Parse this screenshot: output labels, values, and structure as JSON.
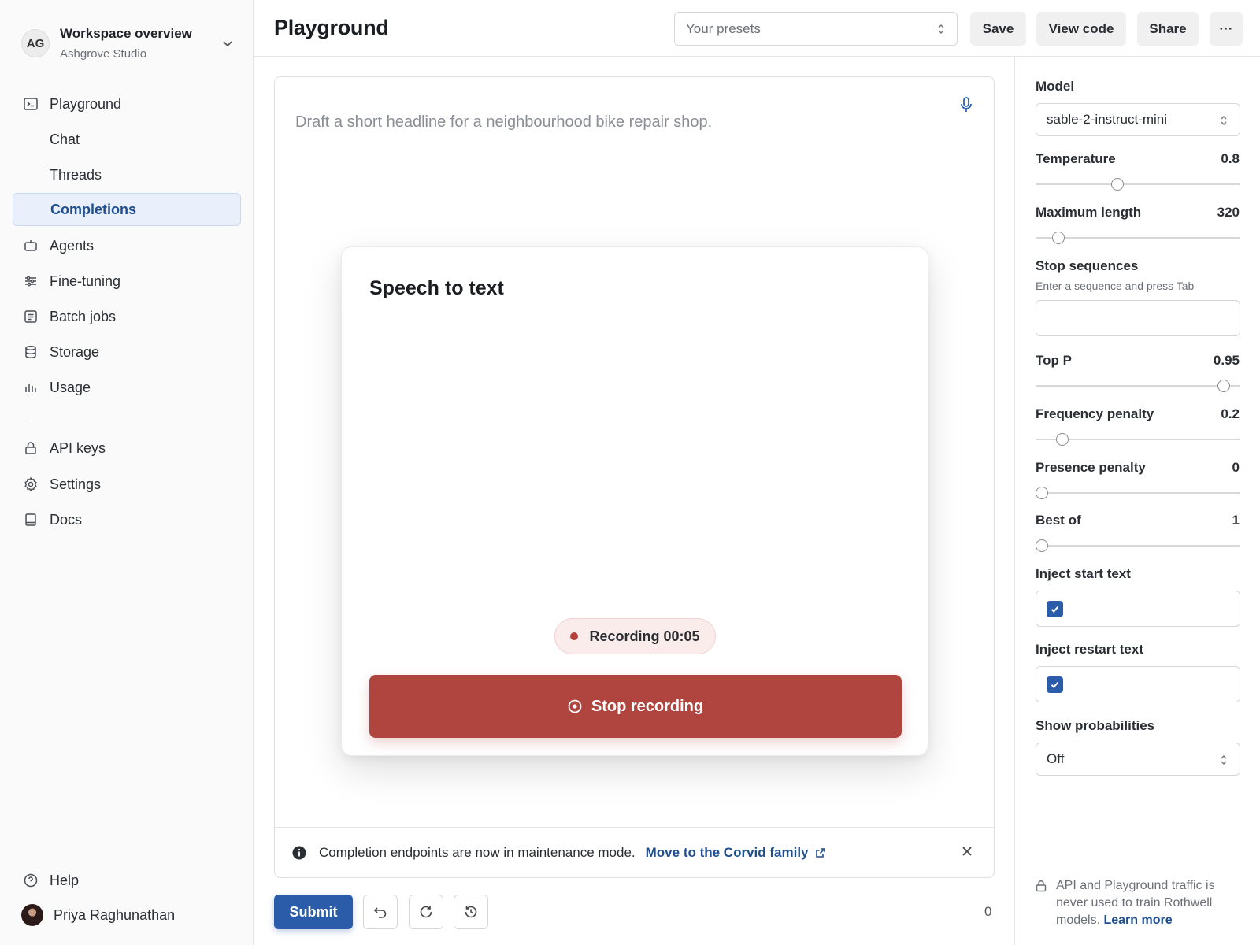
{
  "workspace": {
    "initials": "AG",
    "title": "Workspace overview",
    "subtitle": "Ashgrove Studio"
  },
  "sidebar": {
    "items": [
      {
        "label": "Playground",
        "icon": "terminal-icon"
      },
      {
        "label": "Chat"
      },
      {
        "label": "Threads"
      },
      {
        "label": "Completions",
        "active": true
      },
      {
        "label": "Agents",
        "icon": "robot-icon"
      },
      {
        "label": "Fine-tuning",
        "icon": "sliders-icon"
      },
      {
        "label": "Batch jobs",
        "icon": "list-icon"
      },
      {
        "label": "Storage",
        "icon": "database-icon"
      },
      {
        "label": "Usage",
        "icon": "bar-chart-icon"
      },
      {
        "label": "API keys",
        "icon": "lock-icon"
      },
      {
        "label": "Settings",
        "icon": "gear-icon"
      },
      {
        "label": "Docs",
        "icon": "book-icon"
      }
    ],
    "help": "Help",
    "user": "Priya Raghunathan"
  },
  "header": {
    "title": "Playground",
    "presets_placeholder": "Your presets",
    "save": "Save",
    "view_code": "View code",
    "share": "Share",
    "more": "···"
  },
  "editor": {
    "placeholder": "Draft a short headline for a neighbourhood bike repair shop.",
    "notice": "Completion endpoints are now in maintenance mode.",
    "notice_link": "Move to the Corvid family"
  },
  "modal": {
    "title": "Speech to text",
    "status": "Recording 00:05",
    "stop_label": "Stop recording"
  },
  "footer": {
    "submit": "Submit",
    "token_count": "0"
  },
  "settings": {
    "model_label": "Model",
    "model": "sable-2-instruct-mini",
    "temperature": {
      "label": "Temperature",
      "value": "0.8",
      "fraction": 0.4
    },
    "max_length": {
      "label": "Maximum length",
      "value": "320",
      "fraction": 0.11
    },
    "stop_sequences": {
      "label": "Stop sequences",
      "hint": "Enter a sequence and press Tab"
    },
    "top_p": {
      "label": "Top P",
      "value": "0.95",
      "fraction": 0.92
    },
    "frequency_penalty": {
      "label": "Frequency penalty",
      "value": "0.2",
      "fraction": 0.13
    },
    "presence_penalty": {
      "label": "Presence penalty",
      "value": "0",
      "fraction": 0.03
    },
    "best_of": {
      "label": "Best of",
      "value": "1",
      "fraction": 0.03
    },
    "inject_start": {
      "label": "Inject start text",
      "checked": true
    },
    "inject_restart": {
      "label": "Inject restart text",
      "checked": true
    },
    "show_probabilities": {
      "label": "Show probabilities",
      "value": "Off"
    },
    "privacy_text": "API and Playground traffic is never used to train Rothwell models.",
    "privacy_link": "Learn more"
  },
  "colors": {
    "accent": "#2a5caa",
    "danger": "#b0443f",
    "active_bg": "#e9f0fb"
  }
}
